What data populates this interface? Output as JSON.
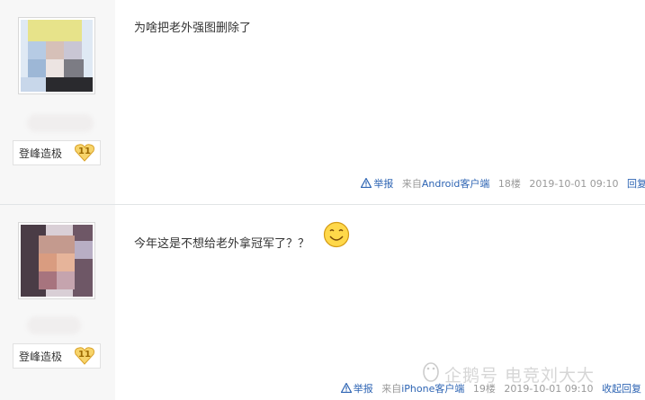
{
  "posts": [
    {
      "content": "为啥把老外强图删除了",
      "rank_label": "登峰造极",
      "level": "11",
      "report": "举报",
      "client_prefix": "来自",
      "client": "Android客户端",
      "floor": "18楼",
      "time": "2019-10-01 09:10",
      "reply": "回复"
    },
    {
      "content": "今年这是不想给老外拿冠军了？？",
      "rank_label": "登峰造极",
      "level": "11",
      "report": "举报",
      "client_prefix": "来自",
      "client": "iPhone客户端",
      "floor": "19楼",
      "time": "2019-10-01 09:10",
      "reply": "收起回复"
    }
  ],
  "watermark": "企鹅号 电竞刘大大",
  "colors": {
    "link": "#2d64b3",
    "meta": "#999999",
    "sidebar": "#f7f7f7",
    "divider": "#e1e4e6"
  },
  "icons": [
    "warning-icon",
    "level-heart-icon",
    "smile-emoji-icon",
    "penguin-logo-icon"
  ]
}
